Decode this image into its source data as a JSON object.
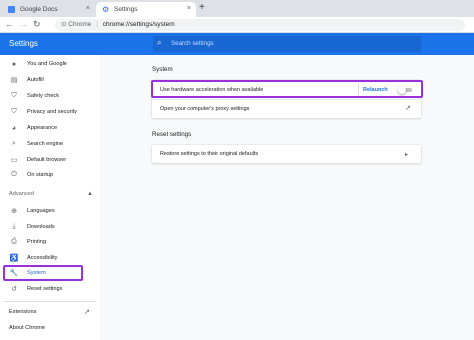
{
  "tabs": [
    {
      "label": "Google Docs",
      "close": "×"
    },
    {
      "label": "Settings",
      "close": "×"
    }
  ],
  "new_tab_glyph": "+",
  "toolbar": {
    "back": "←",
    "forward": "→",
    "reload": "↻",
    "site_info_icon": "⊙",
    "chip": "Chrome",
    "separator": "|",
    "url": "chrome://settings/system"
  },
  "header": {
    "title": "Settings",
    "search_placeholder": "Search settings",
    "search_icon": "⌕"
  },
  "sidebar": {
    "items": [
      {
        "label": "You and Google",
        "icon": "person-icon",
        "glyph": "●"
      },
      {
        "label": "Autofill",
        "icon": "clipboard-icon",
        "glyph": "▤"
      },
      {
        "label": "Safety check",
        "icon": "shield-icon",
        "glyph": "⛉"
      },
      {
        "label": "Privacy and security",
        "icon": "shield-lock-icon",
        "glyph": "⛉"
      },
      {
        "label": "Appearance",
        "icon": "palette-icon",
        "glyph": "◕"
      },
      {
        "label": "Search engine",
        "icon": "search-icon",
        "glyph": "⌕"
      },
      {
        "label": "Default browser",
        "icon": "browser-icon",
        "glyph": "▭"
      },
      {
        "label": "On startup",
        "icon": "power-icon",
        "glyph": "⏻"
      }
    ],
    "advanced_label": "Advanced",
    "advanced_arrow": "▲",
    "advanced_items": [
      {
        "label": "Languages",
        "icon": "globe-icon",
        "glyph": "⊕"
      },
      {
        "label": "Downloads",
        "icon": "download-icon",
        "glyph": "⤓"
      },
      {
        "label": "Printing",
        "icon": "printer-icon",
        "glyph": "⎙"
      },
      {
        "label": "Accessibility",
        "icon": "accessibility-icon",
        "glyph": "♿"
      },
      {
        "label": "System",
        "icon": "wrench-icon",
        "glyph": "🔧"
      },
      {
        "label": "Reset settings",
        "icon": "history-icon",
        "glyph": "↺"
      }
    ],
    "extensions_label": "Extensions",
    "extensions_icon": "↗",
    "about_label": "About Chrome"
  },
  "main": {
    "system_title": "System",
    "hw_accel_label": "Use hardware acceleration when available",
    "relaunch_label": "Relaunch",
    "hw_accel_enabled": false,
    "proxy_label": "Open your computer's proxy settings",
    "proxy_icon": "↗",
    "reset_title": "Reset settings",
    "restore_label": "Restore settings to their original defaults",
    "restore_icon": "▸"
  },
  "colors": {
    "accent": "#1a73e8",
    "highlight": "#9b30d8"
  }
}
